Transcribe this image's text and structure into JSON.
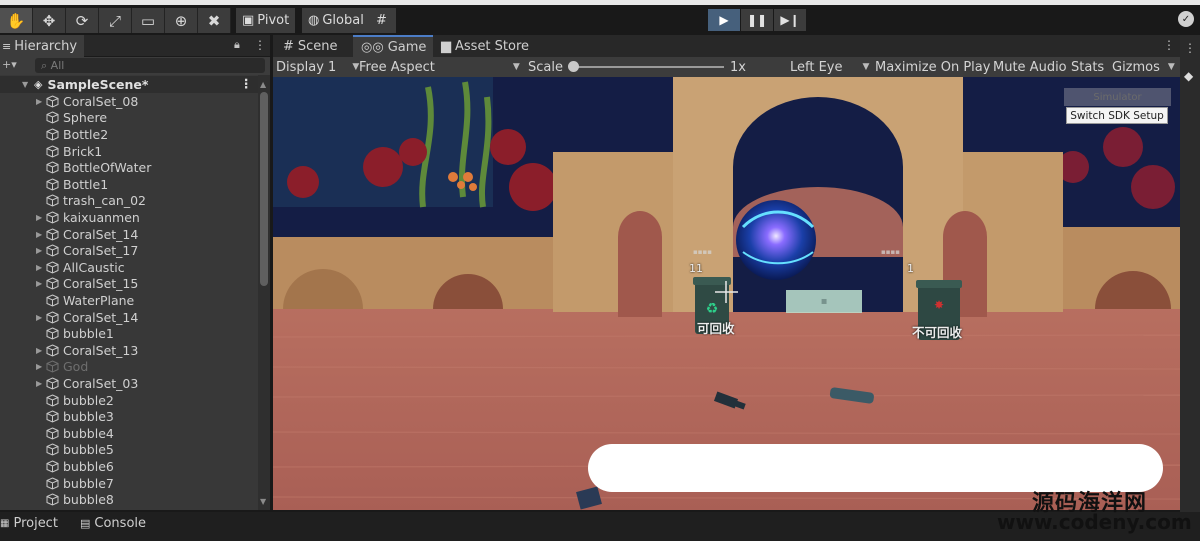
{
  "toolbar": {
    "tools": [
      "hand-tool-icon",
      "move-tool-icon",
      "rotate-tool-icon",
      "scale-tool-icon",
      "rect-tool-icon",
      "transform-tool-icon",
      "custom-tool-icon"
    ],
    "pivot_label": "Pivot",
    "global_label": "Global"
  },
  "hierarchy": {
    "tab_label": "Hierarchy",
    "search_placeholder": "All",
    "scene_name": "SampleScene*",
    "items": [
      {
        "label": "CoralSet_08",
        "foldable": true
      },
      {
        "label": "Sphere",
        "foldable": false
      },
      {
        "label": "Bottle2",
        "foldable": false
      },
      {
        "label": "Brick1",
        "foldable": false
      },
      {
        "label": "BottleOfWater",
        "foldable": false
      },
      {
        "label": "Bottle1",
        "foldable": false
      },
      {
        "label": "trash_can_02",
        "foldable": false
      },
      {
        "label": "kaixuanmen",
        "foldable": true
      },
      {
        "label": "CoralSet_14",
        "foldable": true
      },
      {
        "label": "CoralSet_17",
        "foldable": true
      },
      {
        "label": "AllCaustic",
        "foldable": true
      },
      {
        "label": "CoralSet_15",
        "foldable": true
      },
      {
        "label": "WaterPlane",
        "foldable": false
      },
      {
        "label": "CoralSet_14",
        "foldable": true
      },
      {
        "label": "bubble1",
        "foldable": false
      },
      {
        "label": "CoralSet_13",
        "foldable": true
      },
      {
        "label": "God",
        "foldable": true,
        "disabled": true
      },
      {
        "label": "CoralSet_03",
        "foldable": true
      },
      {
        "label": "bubble2",
        "foldable": false
      },
      {
        "label": "bubble3",
        "foldable": false
      },
      {
        "label": "bubble4",
        "foldable": false
      },
      {
        "label": "bubble5",
        "foldable": false
      },
      {
        "label": "bubble6",
        "foldable": false
      },
      {
        "label": "bubble7",
        "foldable": false
      },
      {
        "label": "bubble8",
        "foldable": false
      }
    ]
  },
  "bottom_tabs": {
    "project_label": "Project",
    "console_label": "Console"
  },
  "game_tabs": {
    "scene_label": "Scene",
    "game_label": "Game",
    "asset_store_label": "Asset Store"
  },
  "game_controls": {
    "display": "Display 1",
    "aspect": "Free Aspect",
    "scale_label": "Scale",
    "scale_value": "1x",
    "eye": "Left Eye",
    "maximize": "Maximize On Play",
    "mute": "Mute Audio",
    "stats": "Stats",
    "gizmos": "Gizmos",
    "scale_slider_fraction": 0.0
  },
  "game_view": {
    "recyclable_label": "可回收",
    "nonrecyclable_label": "不可回收",
    "left_count": "11",
    "right_count": "1",
    "simulator_label": "Simulator",
    "switch_sdk_label": "Switch SDK Setup"
  },
  "watermark": {
    "site_name": "源码海洋网",
    "site_url": "www.codeny.com"
  },
  "colors": {
    "play_active": "#46607c",
    "panel": "#383838",
    "tab_accent": "#4c7dc7",
    "sand": "#b06a5e",
    "stone": "#c39a6b"
  }
}
